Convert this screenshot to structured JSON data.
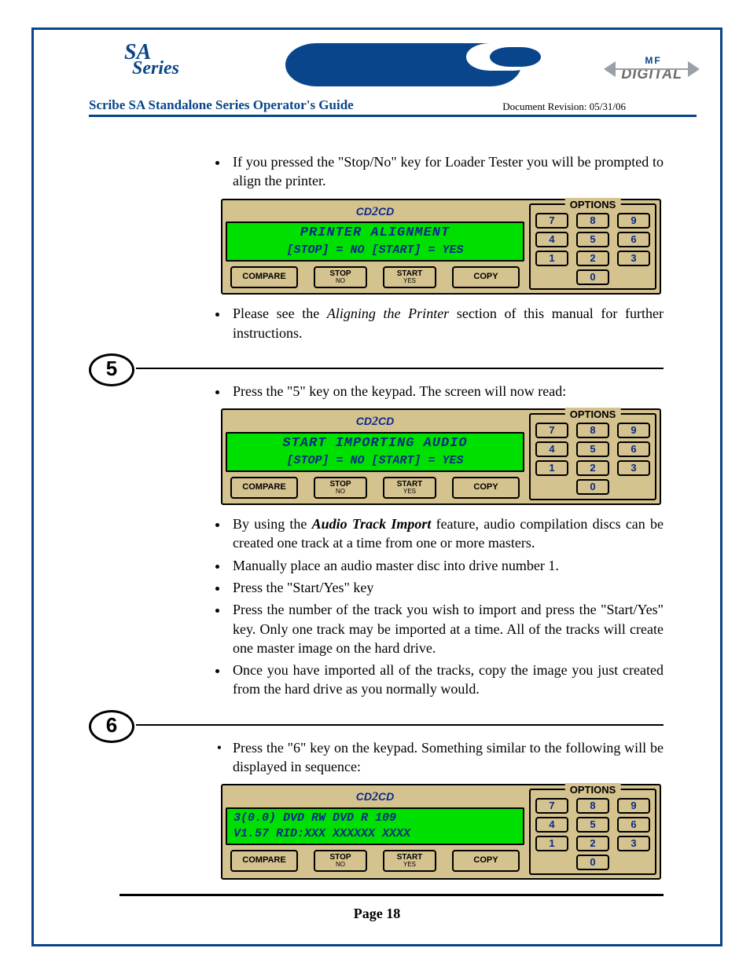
{
  "header": {
    "logo_top": "SA",
    "logo_bottom": "Series",
    "digital_top": "MF",
    "digital_main": "DIGITAL",
    "title": "Scribe SA Standalone Series Operator's Guide",
    "revision": "Document Revision: 05/31/06"
  },
  "intro_bullets": [
    "If you pressed the \"Stop/No\" key for Loader Tester you will be prompted to align the printer."
  ],
  "panel_brand": "CD2CD",
  "panels": {
    "printer": {
      "line1": "PRINTER ALIGNMENT",
      "line2": "[STOP] = NO  [START] = YES"
    },
    "audio": {
      "line1": "START IMPORTING AUDIO",
      "line2": "[STOP] = NO  [START] = YES"
    },
    "drive": {
      "line1": "3(0.0) DVD RW   DVD R 109",
      "line2": "V1.57   RID:XXX XXXXXX XXXX"
    }
  },
  "panel_buttons": {
    "compare": "COMPARE",
    "stop": "STOP",
    "stop_sub": "NO",
    "start": "START",
    "start_sub": "YES",
    "copy": "COPY",
    "options": "OPTIONS",
    "keys": [
      "7",
      "8",
      "9",
      "4",
      "5",
      "6",
      "1",
      "2",
      "3",
      "0"
    ]
  },
  "after_printer": {
    "pre": "Please see the ",
    "em": "Aligning the Printer",
    "post": " section of this manual for further instructions."
  },
  "step5": {
    "num": "5",
    "lead": "Press the \"5\" key on the keypad. The screen will now read:",
    "points_a_pre": "By using the ",
    "points_a_em": "Audio Track Import",
    "points_a_post": " feature, audio compilation discs can be created one track at a time from one or more masters.",
    "points_rest": [
      "Manually place an audio master disc into drive number 1.",
      "Press the \"Start/Yes\" key",
      "Press the number of the track you wish to import and press the \"Start/Yes\" key. Only one track may be imported at a time. All of the tracks will create one master image on the hard drive.",
      "Once you have imported all of the tracks, copy the image you just created from the hard drive as you normally would."
    ]
  },
  "step6": {
    "num": "6",
    "lead": "Press the \"6\" key on the keypad. Something similar to the following will be displayed in sequence:"
  },
  "footer": {
    "page": "Page 18"
  }
}
